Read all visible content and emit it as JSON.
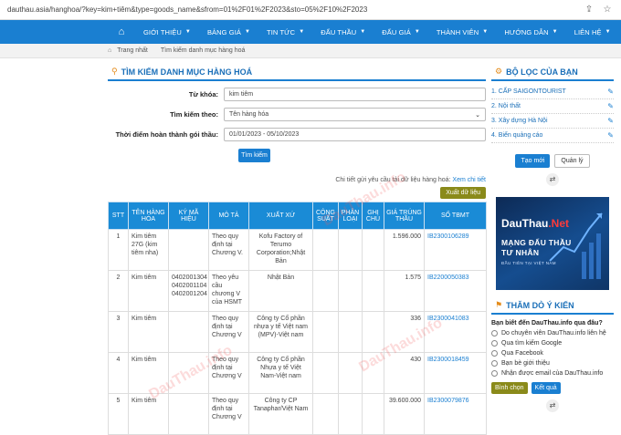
{
  "browser": {
    "url": "dauthau.asia/hanghoa/?key=kim+tiêm&type=goods_name&sfrom=01%2F01%2F2023&sto=05%2F10%2F2023"
  },
  "nav": {
    "items": [
      {
        "label": "GIỚI THIỆU",
        "caret": true
      },
      {
        "label": "BẢNG GIÁ",
        "caret": true
      },
      {
        "label": "TIN TỨC",
        "caret": true
      },
      {
        "label": "ĐẤU THẦU",
        "caret": true
      },
      {
        "label": "ĐẤU GIÁ",
        "caret": true
      },
      {
        "label": "THÀNH VIÊN",
        "caret": true
      },
      {
        "label": "HƯỚNG DẪN",
        "caret": true
      },
      {
        "label": "LIÊN HỆ",
        "caret": true
      }
    ]
  },
  "breadcrumb": [
    "Trang nhất",
    "Tìm kiếm danh mục hàng hoá"
  ],
  "search": {
    "title": "TÌM KIẾM DANH MỤC HÀNG HOÁ",
    "keyword_label": "Từ khóa:",
    "keyword_value": "kim tiêm",
    "searchby_label": "Tìm kiếm theo:",
    "searchby_value": "Tên hàng hóa",
    "time_label": "Thời điểm hoàn thành gói thầu:",
    "time_value": "01/01/2023 - 05/10/2023",
    "button": "Tìm kiếm"
  },
  "notice": {
    "text": "Chi tiết gửi yêu cầu tải dữ liệu hàng hoá:",
    "link": "Xem chi tiết"
  },
  "export_label": "Xuất dữ liệu",
  "table": {
    "headers": [
      "STT",
      "TÊN HÀNG HÓA",
      "KÝ MÃ HIỆU",
      "MÔ TẢ",
      "XUẤT XỨ",
      "CÔNG SUẤT",
      "PHÂN LOẠI",
      "GHI CHÚ",
      "GIÁ TRÚNG THẦU",
      "SỐ TBMT"
    ],
    "rows": [
      {
        "stt": "1",
        "name": "Kim tiêm 27G (kim tiêm nha)",
        "code": "",
        "desc": "Theo quy định tại Chương V.",
        "origin": "Kofu Factory of Terumo Corporation;Nhật Bản",
        "capacity": "",
        "category": "",
        "note": "",
        "price": "1.596.000",
        "tbmt": "IB2300106289"
      },
      {
        "stt": "2",
        "name": "Kim tiêm",
        "code": "0402001304 0402001104 0402001204",
        "desc": "Theo yêu cầu chương V của HSMT",
        "origin": "Nhật Bản",
        "capacity": "",
        "category": "",
        "note": "",
        "price": "1.575",
        "tbmt": "IB2200050383"
      },
      {
        "stt": "3",
        "name": "Kim tiêm",
        "code": "",
        "desc": "Theo quy định tại Chương V",
        "origin": "Công ty Cổ phần nhựa y tế Việt nam (MPV)-Việt nam",
        "capacity": "",
        "category": "",
        "note": "",
        "price": "336",
        "tbmt": "IB2300041083"
      },
      {
        "stt": "4",
        "name": "Kim tiêm",
        "code": "",
        "desc": "Theo quy định tại Chương V",
        "origin": "Công ty Cổ phần Nhựa y tế Việt Nam-Việt nam",
        "capacity": "",
        "category": "",
        "note": "",
        "price": "430",
        "tbmt": "IB2300018459"
      },
      {
        "stt": "5",
        "name": "Kim tiêm",
        "code": "",
        "desc": "Theo quy định tại Chương V",
        "origin": "Công ty CP Tanaphar/Việt Nam",
        "capacity": "",
        "category": "",
        "note": "",
        "price": "39.600.000",
        "tbmt": "IB2300079876"
      }
    ]
  },
  "filter": {
    "title": "BỘ LỌC CỦA BẠN",
    "items": [
      "CẤP SAIGONTOURIST",
      "Nội thất",
      "Xây dựng Hà Nội",
      "Biển quảng cáo"
    ],
    "create_label": "Tạo mới",
    "manage_label": "Quản lý"
  },
  "ad": {
    "logo_main": "DauThau",
    "logo_net": ".Net",
    "line1": "MẠNG ĐẤU THẦU",
    "line2": "TƯ NHÂN",
    "line3": "ĐẦU TIÊN TẠI VIỆT NAM"
  },
  "poll": {
    "title": "THĂM DÒ Ý KIẾN",
    "question": "Bạn biết đến DauThau.info qua đâu?",
    "options": [
      "Do chuyên viên DauThau.info liên hệ",
      "Qua tìm kiếm Google",
      "Qua Facebook",
      "Bạn bè giới thiệu",
      "Nhận được email của DauThau.info"
    ],
    "vote_label": "Bình chọn",
    "result_label": "Kết quả"
  },
  "watermark": "DauThau.info",
  "colors": {
    "nav": "#1a7fd1",
    "header": "#1a8bd6",
    "olive": "#8a8a1a",
    "accent": "#e48c1c"
  }
}
